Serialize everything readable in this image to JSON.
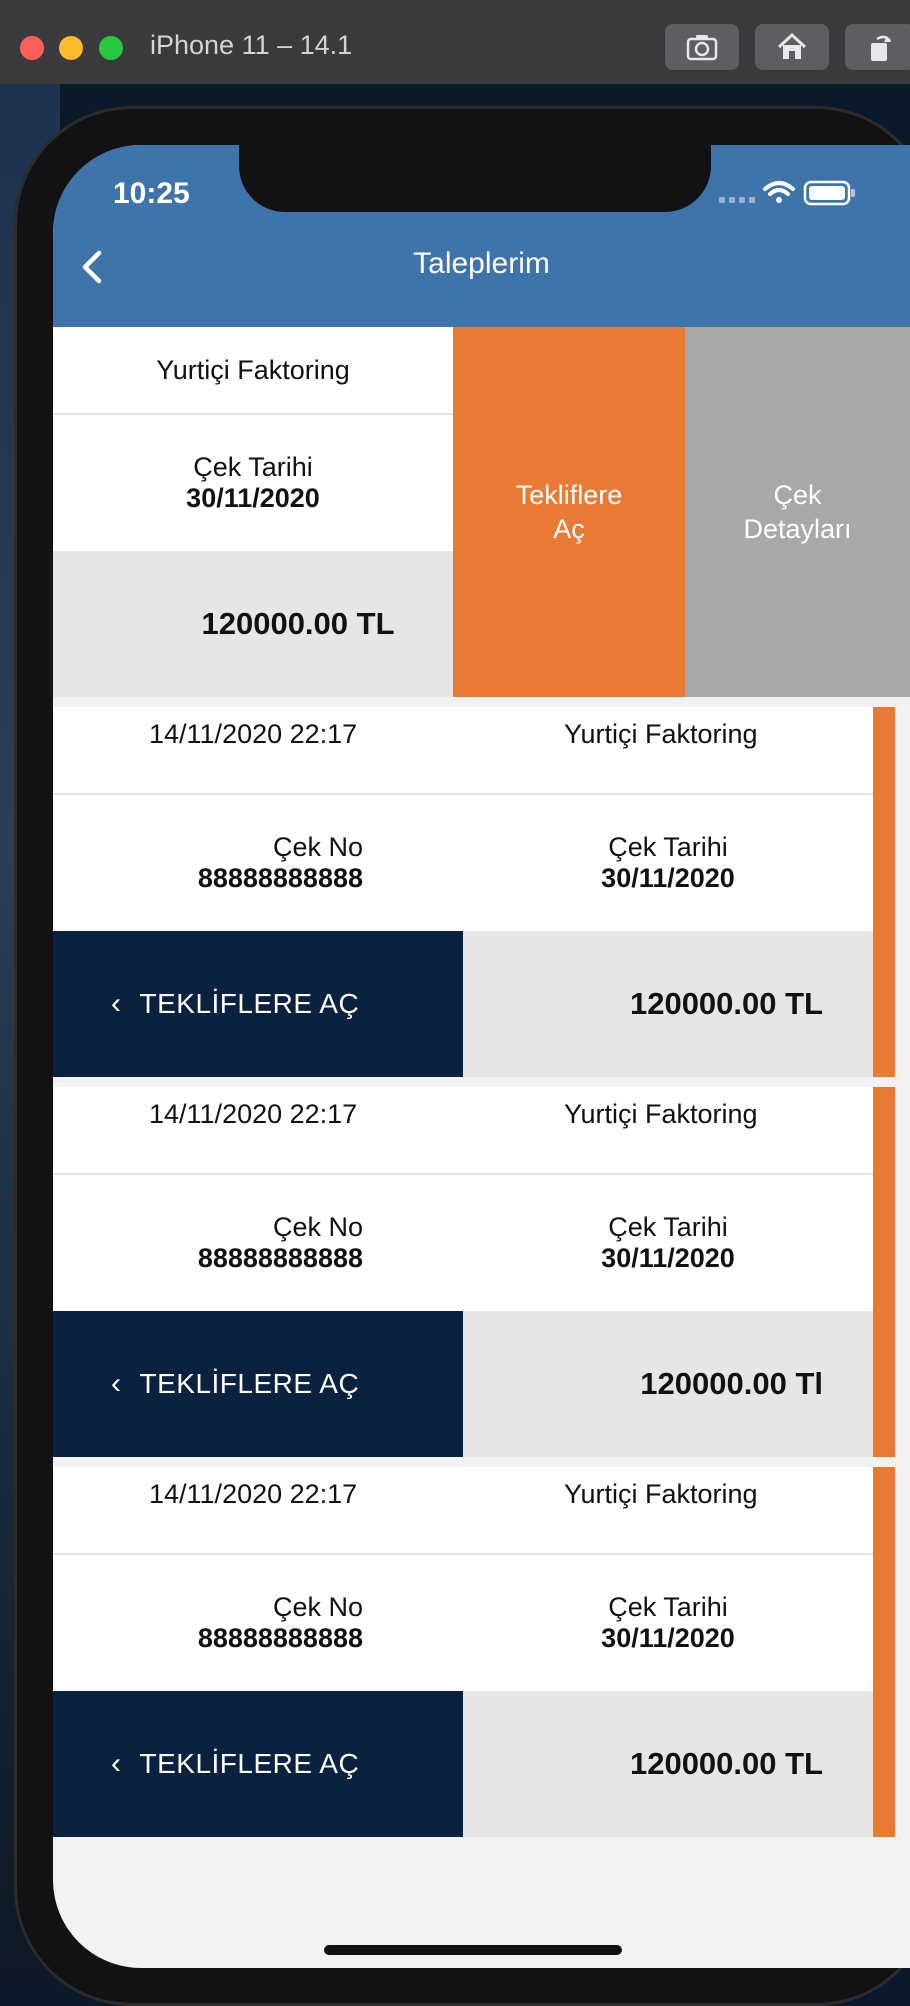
{
  "simulator": {
    "title": "iPhone 11 – 14.1",
    "buttons": [
      "screenshot-icon",
      "home-icon",
      "rotate-icon"
    ]
  },
  "status_bar": {
    "time": "10:25"
  },
  "nav": {
    "title": "Taleplerim",
    "back_icon": "chevron-left-icon"
  },
  "colors": {
    "nav": "#3f74aa",
    "orange": "#e87a33",
    "navy": "#0b2140",
    "grey_action": "#a8a8a8"
  },
  "swiped_row": {
    "company": "Yurtiçi Faktoring",
    "date_label": "Çek Tarihi",
    "date_value": "30/11/2020",
    "amount": "120000.00 TL",
    "action_open": "Tekliflere\nAç",
    "action_details": "Çek\nDetayları"
  },
  "rows": [
    {
      "datetime": "14/11/2020 22:17",
      "company": "Yurtiçi Faktoring",
      "no_label": "Çek No",
      "no_value": "88888888888",
      "date_label": "Çek Tarihi",
      "date_value": "30/11/2020",
      "swipe_label": "TEKLİFLERE AÇ",
      "amount": "120000.00 TL"
    },
    {
      "datetime": "14/11/2020 22:17",
      "company": "Yurtiçi Faktoring",
      "no_label": "Çek No",
      "no_value": "88888888888",
      "date_label": "Çek Tarihi",
      "date_value": "30/11/2020",
      "swipe_label": "TEKLİFLERE AÇ",
      "amount": "120000.00 Tl"
    },
    {
      "datetime": "14/11/2020 22:17",
      "company": "Yurtiçi Faktoring",
      "no_label": "Çek No",
      "no_value": "88888888888",
      "date_label": "Çek Tarihi",
      "date_value": "30/11/2020",
      "swipe_label": "TEKLİFLERE AÇ",
      "amount": "120000.00 TL"
    }
  ]
}
